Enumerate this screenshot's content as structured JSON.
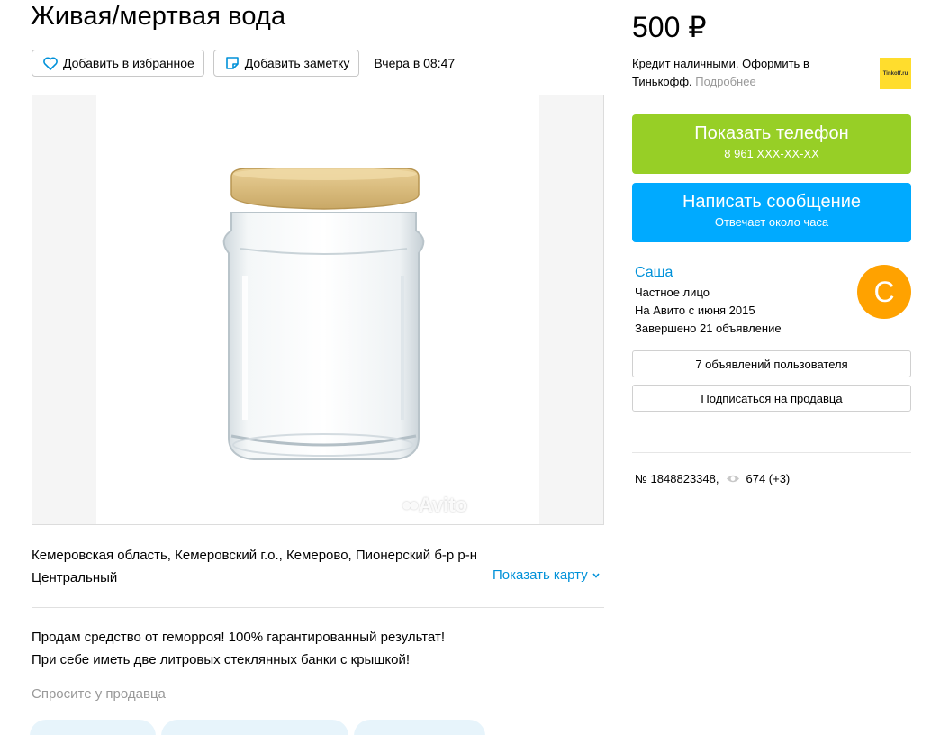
{
  "listing": {
    "title": "Живая/мертвая вода",
    "favorite_label": "Добавить в избранное",
    "note_label": "Добавить заметку",
    "date": "Вчера в 08:47",
    "watermark": "Avito",
    "address": "Кемеровская область, Кемеровский г.о., Кемерово, Пионерский б-р р-н Центральный",
    "map_label": "Показать карту",
    "description_line1": "Продам средство от геморроя! 100% гарантированный результат!",
    "description_line2": "При себе иметь две литровых стеклянных банки с крышкой!",
    "ask_label": "Спросите у продавца"
  },
  "sidebar": {
    "price": "500 ₽",
    "credit_text": "Кредит наличными. Оформить в Тинькофф.",
    "credit_more": "Подробнее",
    "tinkoff_logo": "Tinkoff.ru",
    "phone_button": "Показать телефон",
    "phone_number": "8 961 XXX-XX-XX",
    "message_button": "Написать сообщение",
    "message_sub": "Отвечает около часа",
    "seller_name": "Саша",
    "seller_type": "Частное лицо",
    "seller_since": "На Авито с июня 2015",
    "seller_completed": "Завершено 21 объявление",
    "avatar_letter": "С",
    "ads_button": "7 объявлений пользователя",
    "subscribe_button": "Подписаться на продавца",
    "ad_number": "№ 1848823348,",
    "views": "674 (+3)"
  },
  "colors": {
    "green_button": "#97cf26",
    "blue_button": "#00aaff",
    "link": "#0091d9",
    "avatar": "#ffa200",
    "tinkoff": "#ffdd2d"
  },
  "icons": [
    "heart-icon",
    "note-icon",
    "eye-icon",
    "chevron-down-icon"
  ]
}
